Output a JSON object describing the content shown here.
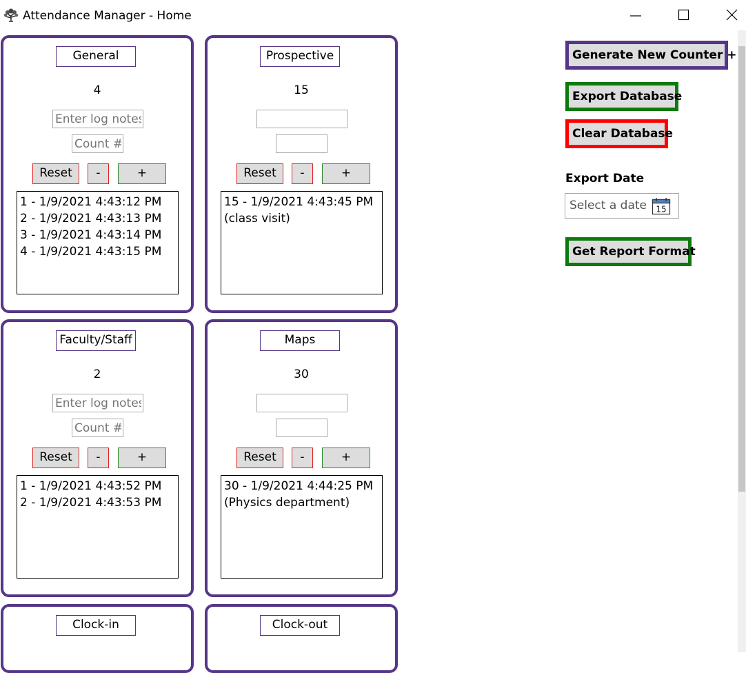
{
  "window": {
    "title": "Attendance Manager - Home",
    "controls": {
      "minimize": "—",
      "maximize": "☐",
      "close": "✕"
    }
  },
  "counters": [
    {
      "name": "General",
      "count": "4",
      "notes_placeholder": "Enter log notes",
      "count_placeholder": "Count #",
      "reset_label": "Reset",
      "minus_label": "-",
      "plus_label": "+",
      "log": [
        "1 - 1/9/2021 4:43:12 PM",
        "2 - 1/9/2021 4:43:13 PM",
        "3 - 1/9/2021 4:43:14 PM",
        "4 - 1/9/2021 4:43:15 PM"
      ]
    },
    {
      "name": "Prospective",
      "count": "15",
      "notes_placeholder": "",
      "count_placeholder": "",
      "reset_label": "Reset",
      "minus_label": "-",
      "plus_label": "+",
      "log": [
        "15 - 1/9/2021 4:43:45 PM",
        "(class visit)"
      ]
    },
    {
      "name": "Faculty/Staff",
      "count": "2",
      "notes_placeholder": "Enter log notes",
      "count_placeholder": "Count #",
      "reset_label": "Reset",
      "minus_label": "-",
      "plus_label": "+",
      "log": [
        "1 - 1/9/2021 4:43:52 PM",
        "2 - 1/9/2021 4:43:53 PM"
      ]
    },
    {
      "name": "Maps",
      "count": "30",
      "notes_placeholder": "",
      "count_placeholder": "",
      "reset_label": "Reset",
      "minus_label": "-",
      "plus_label": "+",
      "log": [
        "30 - 1/9/2021 4:44:25 PM",
        "(Physics department)"
      ]
    },
    {
      "name": "Clock-in"
    },
    {
      "name": "Clock-out"
    }
  ],
  "actions": {
    "generate_label": "Generate New Counter +",
    "export_label": "Export Database",
    "clear_label": "Clear Database",
    "export_date_label": "Export Date",
    "date_placeholder": "Select a date",
    "calendar_day": "15",
    "report_label": "Get Report Format"
  },
  "colors": {
    "card_border": "#553687",
    "generate_border": "#553687",
    "export_border": "#0c7a0c",
    "clear_border": "#ff0000",
    "report_border": "#0c7a0c",
    "button_fill": "#dddddd"
  },
  "icons": {
    "app": "tree-icon",
    "calendar": "calendar-icon"
  }
}
